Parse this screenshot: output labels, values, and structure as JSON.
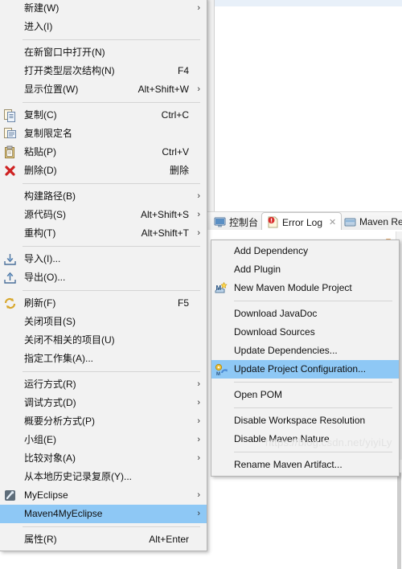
{
  "window": {
    "watermark": "https://blog.csdn.net/yiyiLy"
  },
  "view_tabs": [
    {
      "label": "控制台",
      "icon": "console-icon",
      "active": false
    },
    {
      "label": "Error Log",
      "icon": "error-log-icon",
      "active": true,
      "close": "✕"
    },
    {
      "label": "Maven Rep",
      "icon": "maven-repository-icon",
      "active": false
    }
  ],
  "context_menu": {
    "items": [
      {
        "label": "新建(W)",
        "accel": "",
        "arrow": "›",
        "icon": "",
        "sep_after": false
      },
      {
        "label": "进入(I)",
        "accel": "",
        "arrow": "",
        "icon": "",
        "sep_after": true
      },
      {
        "label": "在新窗口中打开(N)",
        "accel": "",
        "arrow": "",
        "icon": "",
        "sep_after": false
      },
      {
        "label": "打开类型层次结构(N)",
        "accel": "F4",
        "arrow": "",
        "icon": "",
        "sep_after": false
      },
      {
        "label": "显示位置(W)",
        "accel": "Alt+Shift+W",
        "arrow": "›",
        "icon": "",
        "sep_after": true
      },
      {
        "label": "复制(C)",
        "accel": "Ctrl+C",
        "arrow": "",
        "icon": "copy-icon",
        "sep_after": false
      },
      {
        "label": "复制限定名",
        "accel": "",
        "arrow": "",
        "icon": "copy-qualified-name-icon",
        "sep_after": false
      },
      {
        "label": "粘贴(P)",
        "accel": "Ctrl+V",
        "arrow": "",
        "icon": "paste-icon",
        "sep_after": false
      },
      {
        "label": "删除(D)",
        "accel": "删除",
        "arrow": "",
        "icon": "delete-icon",
        "sep_after": true
      },
      {
        "label": "构建路径(B)",
        "accel": "",
        "arrow": "›",
        "icon": "",
        "sep_after": false
      },
      {
        "label": "源代码(S)",
        "accel": "Alt+Shift+S",
        "arrow": "›",
        "icon": "",
        "sep_after": false
      },
      {
        "label": "重构(T)",
        "accel": "Alt+Shift+T",
        "arrow": "›",
        "icon": "",
        "sep_after": true
      },
      {
        "label": "导入(I)...",
        "accel": "",
        "arrow": "",
        "icon": "import-icon",
        "sep_after": false
      },
      {
        "label": "导出(O)...",
        "accel": "",
        "arrow": "",
        "icon": "export-icon",
        "sep_after": true
      },
      {
        "label": "刷新(F)",
        "accel": "F5",
        "arrow": "",
        "icon": "refresh-icon",
        "sep_after": false
      },
      {
        "label": "关闭项目(S)",
        "accel": "",
        "arrow": "",
        "icon": "",
        "sep_after": false
      },
      {
        "label": "关闭不相关的项目(U)",
        "accel": "",
        "arrow": "",
        "icon": "",
        "sep_after": false
      },
      {
        "label": "指定工作集(A)...",
        "accel": "",
        "arrow": "",
        "icon": "",
        "sep_after": true
      },
      {
        "label": "运行方式(R)",
        "accel": "",
        "arrow": "›",
        "icon": "",
        "sep_after": false
      },
      {
        "label": "调试方式(D)",
        "accel": "",
        "arrow": "›",
        "icon": "",
        "sep_after": false
      },
      {
        "label": "概要分析方式(P)",
        "accel": "",
        "arrow": "›",
        "icon": "",
        "sep_after": false
      },
      {
        "label": "小组(E)",
        "accel": "",
        "arrow": "›",
        "icon": "",
        "sep_after": false
      },
      {
        "label": "比较对象(A)",
        "accel": "",
        "arrow": "›",
        "icon": "",
        "sep_after": false
      },
      {
        "label": "从本地历史记录复原(Y)...",
        "accel": "",
        "arrow": "",
        "icon": "",
        "sep_after": false
      },
      {
        "label": "MyEclipse",
        "accel": "",
        "arrow": "›",
        "icon": "myeclipse-icon",
        "sep_after": false
      },
      {
        "label": "Maven4MyEclipse",
        "accel": "",
        "arrow": "›",
        "icon": "",
        "selected": true,
        "sep_after": true
      },
      {
        "label": "属性(R)",
        "accel": "Alt+Enter",
        "arrow": "",
        "icon": "",
        "sep_after": false
      }
    ]
  },
  "submenu": {
    "items": [
      {
        "label": "Add Dependency",
        "icon": "",
        "sep_after": false
      },
      {
        "label": "Add Plugin",
        "icon": "",
        "sep_after": false
      },
      {
        "label": "New Maven Module Project",
        "icon": "new-maven-module-icon",
        "sep_after": true
      },
      {
        "label": "Download JavaDoc",
        "icon": "",
        "sep_after": false
      },
      {
        "label": "Download Sources",
        "icon": "",
        "sep_after": false
      },
      {
        "label": "Update Dependencies...",
        "icon": "",
        "sep_after": false
      },
      {
        "label": "Update Project Configuration...",
        "icon": "update-project-config-icon",
        "selected": true,
        "sep_after": true
      },
      {
        "label": "Open POM",
        "icon": "",
        "sep_after": true
      },
      {
        "label": "Disable Workspace Resolution",
        "icon": "",
        "sep_after": false
      },
      {
        "label": "Disable Maven Nature",
        "icon": "",
        "sep_after": true
      },
      {
        "label": "Rename Maven Artifact...",
        "icon": "",
        "sep_after": false
      }
    ]
  },
  "colors": {
    "selection": "#8ec8f5",
    "menu_background": "#f2f2f2",
    "menu_border": "#b4b4b4",
    "separator": "#d4d4d4"
  }
}
